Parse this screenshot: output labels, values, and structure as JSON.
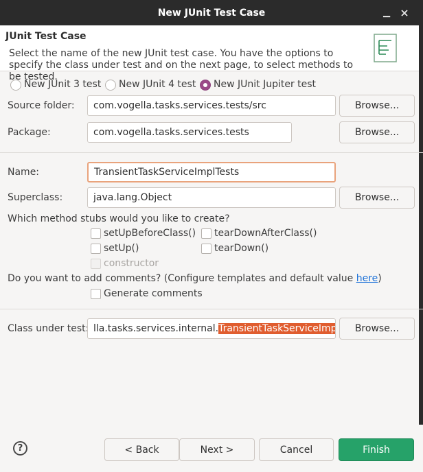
{
  "window": {
    "title": "New JUnit Test Case",
    "minimize_glyph": "▁",
    "maximize_glyph": "☐"
  },
  "header": {
    "title": "JUnit Test Case",
    "description": "Select the name of the new JUnit test case. You have the options to specify the class under test and on the next page, to select methods to be tested.",
    "icon": "junit-wizard-icon"
  },
  "version_options": [
    {
      "label": "New JUnit 3 test",
      "checked": false
    },
    {
      "label": "New JUnit 4 test",
      "checked": false
    },
    {
      "label": "New JUnit Jupiter test",
      "checked": true
    }
  ],
  "source_folder": {
    "label": "Source folder:",
    "value": "com.vogella.tasks.services.tests/src",
    "browse": "Browse..."
  },
  "package": {
    "label": "Package:",
    "value": "com.vogella.tasks.services.tests",
    "browse": "Browse..."
  },
  "name": {
    "label": "Name:",
    "value": "TransientTaskServiceImplTests"
  },
  "superclass": {
    "label": "Superclass:",
    "value": "java.lang.Object",
    "browse": "Browse..."
  },
  "stubs": {
    "question": "Which method stubs would you like to create?",
    "setUpBeforeClass": "setUpBeforeClass()",
    "tearDownAfterClass": "tearDownAfterClass()",
    "setUp": "setUp()",
    "tearDown": "tearDown()",
    "constructor": "constructor"
  },
  "comments": {
    "question_prefix": "Do you want to add comments? (Configure templates and default value ",
    "link": "here",
    "question_suffix": ")",
    "generate": "Generate comments"
  },
  "class_under_test": {
    "label": "Class under test:",
    "value_prefix": "lla.tasks.services.internal.",
    "value_selected": "TransientTaskServiceImpl",
    "browse": "Browse..."
  },
  "footer": {
    "help_glyph": "?",
    "back": "< Back",
    "next": "Next >",
    "cancel": "Cancel",
    "finish": "Finish"
  },
  "colors": {
    "titlebar": "#2b2b2b",
    "accent_radio": "#9b4a88",
    "finish_button": "#26a269",
    "selection": "#e05d2f",
    "focus_border": "#e9a37c",
    "link": "#1c71d8"
  }
}
